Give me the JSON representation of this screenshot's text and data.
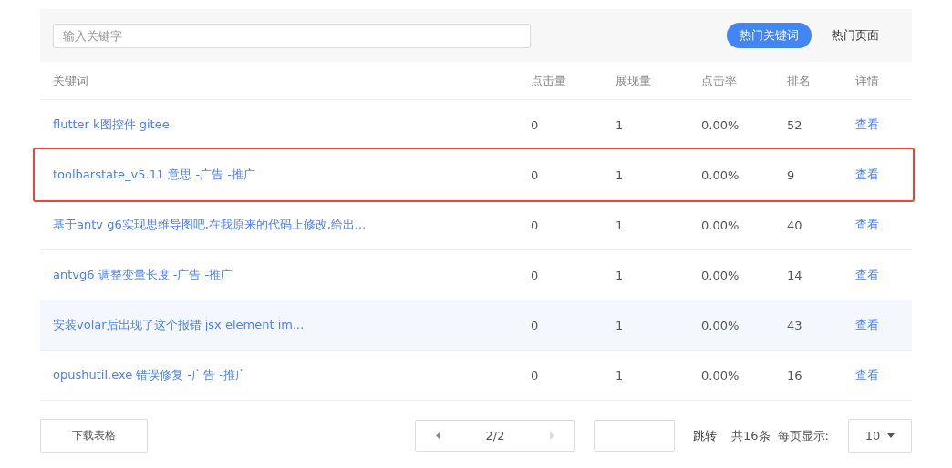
{
  "search": {
    "placeholder": "输入关键字"
  },
  "tabs": [
    {
      "label": "热门关键词",
      "selected": true
    },
    {
      "label": "热门页面",
      "selected": false
    }
  ],
  "table": {
    "columns": [
      "关键词",
      "点击量",
      "展现量",
      "点击率",
      "排名",
      "详情"
    ],
    "rows": [
      {
        "keyword": "flutter k图控件 gitee",
        "clicks": "0",
        "impressions": "1",
        "ctr": "0.00%",
        "rank": "52",
        "action": "查看",
        "hovered": false,
        "outlined": false
      },
      {
        "keyword": "toolbarstate_v5.11 意思 -广告 -推广",
        "clicks": "0",
        "impressions": "1",
        "ctr": "0.00%",
        "rank": "9",
        "action": "查看",
        "hovered": false,
        "outlined": true
      },
      {
        "keyword": "基于antv g6实现思维导图吧,在我原来的代码上修改,给出...",
        "clicks": "0",
        "impressions": "1",
        "ctr": "0.00%",
        "rank": "40",
        "action": "查看",
        "hovered": false,
        "outlined": false
      },
      {
        "keyword": "antvg6 调整变量长度 -广告 -推广",
        "clicks": "0",
        "impressions": "1",
        "ctr": "0.00%",
        "rank": "14",
        "action": "查看",
        "hovered": false,
        "outlined": false
      },
      {
        "keyword": "安装volar后出现了这个报错 jsx element im...",
        "clicks": "0",
        "impressions": "1",
        "ctr": "0.00%",
        "rank": "43",
        "action": "查看",
        "hovered": true,
        "outlined": false
      },
      {
        "keyword": "opushutil.exe 错误修复 -广告 -推广",
        "clicks": "0",
        "impressions": "1",
        "ctr": "0.00%",
        "rank": "16",
        "action": "查看",
        "hovered": false,
        "outlined": false
      }
    ]
  },
  "footer": {
    "download": "下载表格",
    "page": "2/2",
    "prev_disabled": false,
    "next_disabled": true,
    "jump": "跳转",
    "total": "共16条",
    "per_page_label": "每页显示:",
    "per_page": "10"
  }
}
